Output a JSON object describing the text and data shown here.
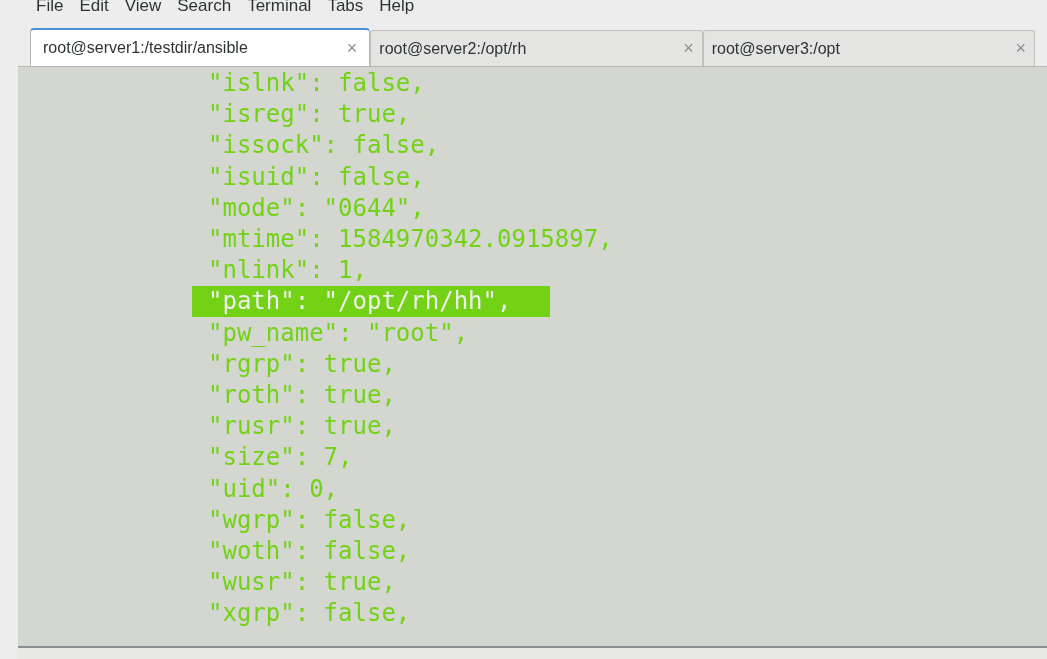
{
  "menu": [
    "File",
    "Edit",
    "View",
    "Search",
    "Terminal",
    "Tabs",
    "Help"
  ],
  "tabs": [
    {
      "label": "root@server1:/testdir/ansible",
      "close": "×",
      "selected": true
    },
    {
      "label": "root@server2:/opt/rh",
      "close": "×",
      "selected": false
    },
    {
      "label": "root@server3:/opt",
      "close": "×",
      "selected": false
    }
  ],
  "lines": [
    {
      "text": "\"islnk\": false,",
      "highlighted": false
    },
    {
      "text": "\"isreg\": true,",
      "highlighted": false
    },
    {
      "text": "\"issock\": false,",
      "highlighted": false
    },
    {
      "text": "\"isuid\": false,",
      "highlighted": false
    },
    {
      "text": "\"mode\": \"0644\",",
      "highlighted": false
    },
    {
      "text": "\"mtime\": 1584970342.0915897,",
      "highlighted": false
    },
    {
      "text": "\"nlink\": 1,",
      "highlighted": false
    },
    {
      "text": "\"path\": \"/opt/rh/hh\",",
      "highlighted": true
    },
    {
      "text": "\"pw_name\": \"root\",",
      "highlighted": false
    },
    {
      "text": "\"rgrp\": true,",
      "highlighted": false
    },
    {
      "text": "\"roth\": true,",
      "highlighted": false
    },
    {
      "text": "\"rusr\": true,",
      "highlighted": false
    },
    {
      "text": "\"size\": 7,",
      "highlighted": false
    },
    {
      "text": "\"uid\": 0,",
      "highlighted": false
    },
    {
      "text": "\"wgrp\": false,",
      "highlighted": false
    },
    {
      "text": "\"woth\": false,",
      "highlighted": false
    },
    {
      "text": "\"wusr\": true,",
      "highlighted": false
    },
    {
      "text": "\"xgrp\": false,",
      "highlighted": false
    }
  ]
}
